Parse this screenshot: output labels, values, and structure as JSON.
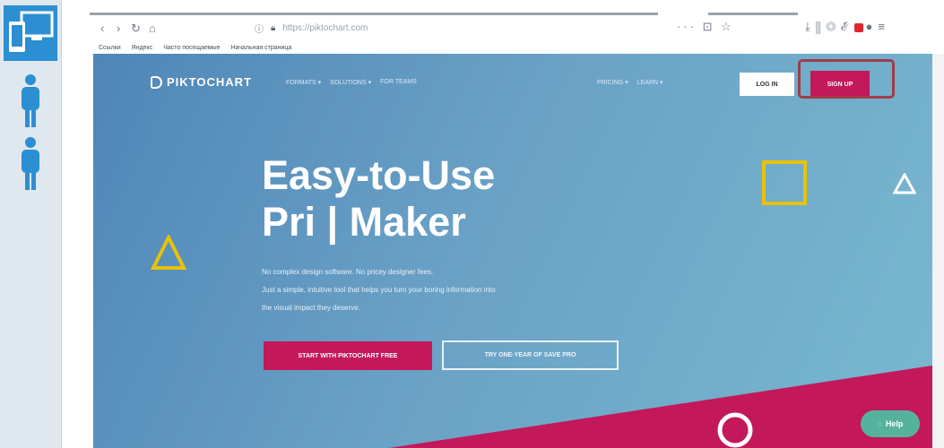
{
  "colors": {
    "hero_gradient_start": "#4f86b7",
    "hero_gradient_end": "#79b8cf",
    "accent_pink": "#c3185a",
    "shape_yellow": "#e7c20a",
    "help_green": "#55b39d",
    "highlight_ring": "#a23b4a",
    "rail_blue": "#2b8fd2"
  },
  "rail": {
    "icons": [
      "devices-icon",
      "person-icon",
      "person-icon"
    ]
  },
  "browser": {
    "url": "https://piktochart.com",
    "page_actions": "··· ⊡ ☆",
    "bookmarks": [
      "Ссылки",
      "Яндекс",
      "Часто посещаемые",
      "Начальная страница"
    ]
  },
  "site": {
    "logo": "PIKTOCHART",
    "nav_left": [
      "FORMATS ▾",
      "SOLUTIONS ▾",
      "FOR TEAMS"
    ],
    "nav_right": [
      "PRICING ▾",
      "LEARN ▾"
    ],
    "login": "LOG IN",
    "signup": "SIGN UP",
    "hero_line1": "Easy-to-Use",
    "hero_line2": "Pri | Maker",
    "hero_sub_1": "No complex design software. No pricey designer fees.",
    "hero_sub_2": "Just a simple, intuitive tool that helps you turn your boring information into",
    "hero_sub_3": "the visual impact they deserve.",
    "cta_primary": "START WITH PIKTOCHART FREE",
    "cta_secondary": "TRY ONE-YEAR OF SAVE PRO",
    "help": "Help"
  }
}
